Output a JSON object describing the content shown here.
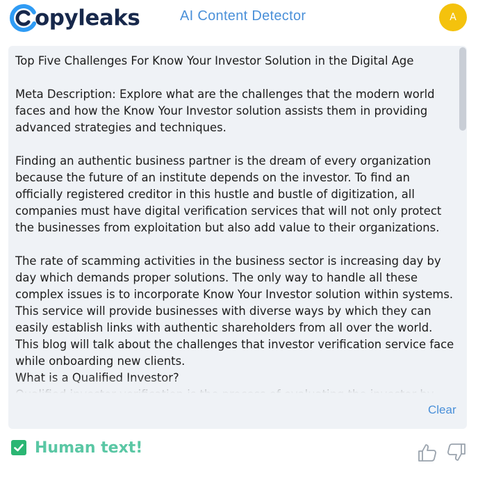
{
  "header": {
    "logo_text": "opyleaks",
    "title": "AI Content Detector",
    "avatar_initial": "A"
  },
  "editor": {
    "text": "Top Five Challenges For Know Your Investor Solution in the Digital Age\n\nMeta Description: Explore what are the challenges that the modern world faces and how the Know Your Investor solution assists them in providing advanced strategies and techniques.\n\nFinding an authentic business partner is the dream of every organization because the future of an institute depends on the investor. To find an officially registered creditor in this hustle and bustle of digitization, all companies must have digital verification services that will not only protect the businesses from exploitation but also add value to their organizations.\n\nThe rate of scamming activities in the business sector is increasing day by day which demands proper solutions. The only way to handle all these complex issues is to incorporate Know Your Investor solution within systems. This service will provide businesses with diverse ways by which they can easily establish links with authentic shareholders from all over the world. This blog will talk about the challenges that investor verification service face while onboarding new clients.\nWhat is a Qualified Investor?\nQualified investor verification is the process of evaluating the investor by",
    "clear_label": "Clear"
  },
  "result": {
    "label": "Human text!",
    "status_color": "#2bb673",
    "text_color": "#5ac7a4"
  },
  "colors": {
    "brand_navy": "#17284b",
    "brand_blue": "#2f9bf4",
    "accent_blue": "#4a90d9",
    "avatar_yellow": "#f4c20d",
    "panel_bg": "#eff2f6"
  },
  "icons": {
    "check": "check-icon",
    "thumbs_up": "thumbs-up-icon",
    "thumbs_down": "thumbs-down-icon"
  }
}
